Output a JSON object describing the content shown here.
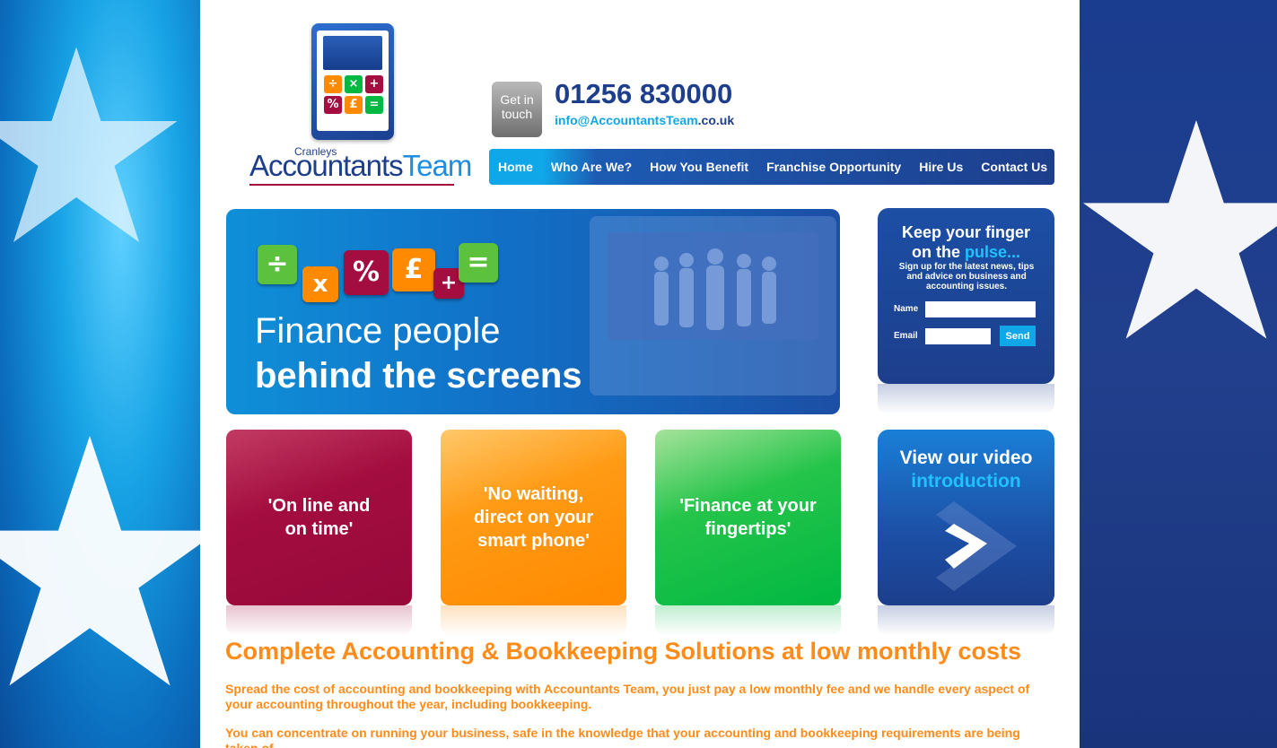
{
  "logo": {
    "cranleys": "Cranleys",
    "accountants": "Accountants",
    "team": "Team",
    "keys": [
      "÷",
      "×",
      "+",
      "%",
      "£",
      "="
    ]
  },
  "contact": {
    "badge_line1": "Get in",
    "badge_line2": "touch",
    "phone": "01256 830000",
    "email_prefix": "info@",
    "email_brand1": "Accountants",
    "email_brand2": "Team",
    "email_suffix": ".co.uk"
  },
  "nav": {
    "items": [
      "Home",
      "Who Are We?",
      "How You Benefit",
      "Franchise Opportunity",
      "Hire Us",
      "Contact Us"
    ]
  },
  "hero": {
    "tiles": [
      "÷",
      "x",
      "%",
      "£",
      "+",
      "="
    ],
    "line1": "Finance people",
    "line2": "behind the screens"
  },
  "signup": {
    "line1": "Keep your finger",
    "line2_prefix": "on the ",
    "line2_highlight": "pulse...",
    "subtitle": "Sign up for the latest news, tips and advice on business and accounting issues.",
    "name_label": "Name",
    "email_label": "Email",
    "send_label": "Send"
  },
  "features": [
    "'On line and on time'",
    "'No waiting, direct on your smart phone'",
    "'Finance at your fingertips'"
  ],
  "video": {
    "line1": "View our video",
    "line2": "introduction"
  },
  "content": {
    "headline": "Complete Accounting & Bookkeeping Solutions at low monthly costs",
    "para1": "Spread the cost of accounting and bookkeeping with Accountants Team, you just pay a low monthly fee and we handle every aspect of your accounting throughout the year, including bookkeeping.",
    "para2": "You can concentrate on running your business, safe in the knowledge that your accounting and bookkeeping requirements are being taken of..."
  },
  "colors": {
    "navy": "#1d3e8c",
    "cyan": "#0fa7e8",
    "orange": "#ff8c1a",
    "crimson": "#a30d3f",
    "green": "#00b842"
  }
}
